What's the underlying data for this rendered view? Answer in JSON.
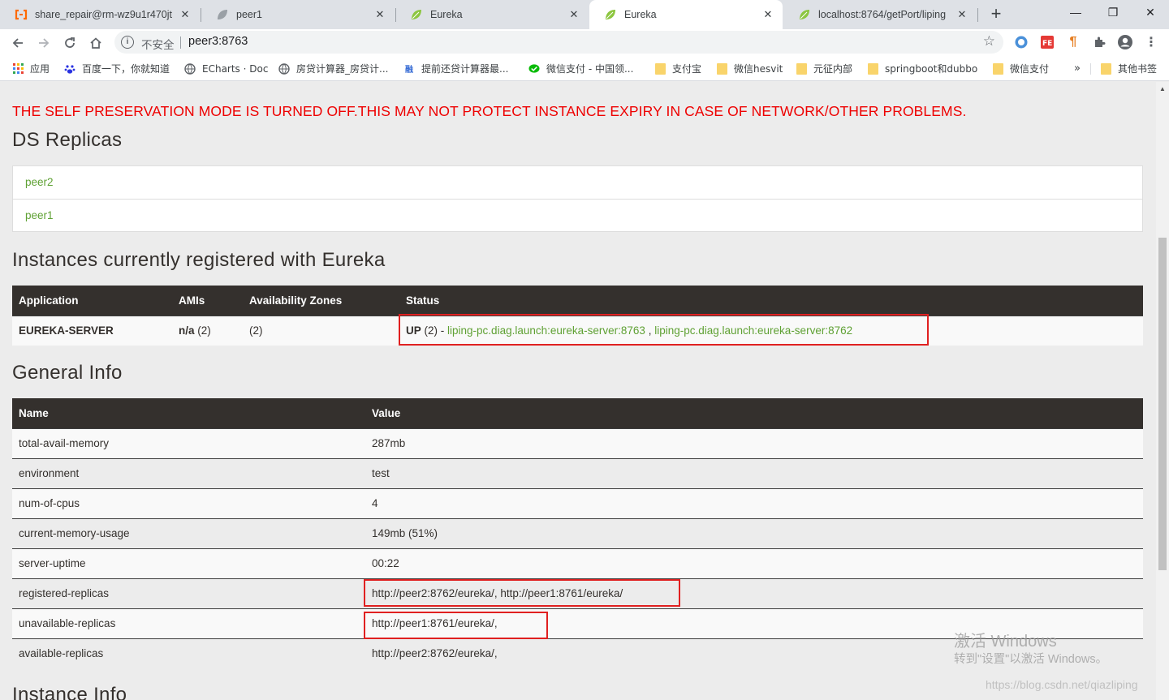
{
  "browser": {
    "tabs": [
      {
        "title": "share_repair@rm-wz9u1r470jt",
        "icon": "alibaba-cloud-icon"
      },
      {
        "title": "peer1",
        "icon": "spring-leaf-icon"
      },
      {
        "title": "Eureka",
        "icon": "spring-leaf-icon"
      },
      {
        "title": "Eureka",
        "icon": "spring-leaf-icon",
        "active": true
      },
      {
        "title": "localhost:8764/getPort/liping",
        "icon": "spring-leaf-icon"
      }
    ],
    "new_tab": "+",
    "window_controls": {
      "minimize": "—",
      "maximize": "❐",
      "close": "✕"
    },
    "address": {
      "security_label": "不安全",
      "url": "peer3:8763"
    },
    "bookmarks": [
      {
        "label": "应用",
        "icon": "apps-grid-icon"
      },
      {
        "label": "百度一下，你就知道",
        "icon": "baidu-paw-icon"
      },
      {
        "label": "ECharts · Doc",
        "icon": "globe-icon"
      },
      {
        "label": "房贷计算器_房贷计...",
        "icon": "globe-icon"
      },
      {
        "label": "提前还贷计算器最...",
        "icon": "rong-icon"
      },
      {
        "label": "微信支付 - 中国领...",
        "icon": "wechat-pay-icon"
      },
      {
        "label": "支付宝",
        "icon": "folder-icon"
      },
      {
        "label": "微信hesvit",
        "icon": "folder-icon"
      },
      {
        "label": "元征内部",
        "icon": "folder-icon"
      },
      {
        "label": "springboot和dubbo",
        "icon": "folder-icon"
      },
      {
        "label": "微信支付",
        "icon": "folder-icon"
      }
    ],
    "bookmarks_overflow": "»",
    "other_bookmarks": "其他书签"
  },
  "page": {
    "warning": "THE SELF PRESERVATION MODE IS TURNED OFF.THIS MAY NOT PROTECT INSTANCE EXPIRY IN CASE OF NETWORK/OTHER PROBLEMS.",
    "replicas_title": "DS Replicas",
    "replicas": [
      "peer2",
      "peer1"
    ],
    "instances_title": "Instances currently registered with Eureka",
    "instances_headers": {
      "application": "Application",
      "amis": "AMIs",
      "zones": "Availability Zones",
      "status": "Status"
    },
    "instances": [
      {
        "application": "EUREKA-SERVER",
        "amis_value": "n/a",
        "amis_count": "(2)",
        "zones": "(2)",
        "status_prefix": "UP",
        "status_count": "(2) - ",
        "link1": "liping-pc.diag.launch:eureka-server:8763",
        "separator": " , ",
        "link2": "liping-pc.diag.launch:eureka-server:8762"
      }
    ],
    "general_title": "General Info",
    "general_headers": {
      "name": "Name",
      "value": "Value"
    },
    "general_rows": [
      {
        "name": "total-avail-memory",
        "value": "287mb"
      },
      {
        "name": "environment",
        "value": "test"
      },
      {
        "name": "num-of-cpus",
        "value": "4"
      },
      {
        "name": "current-memory-usage",
        "value": "149mb (51%)"
      },
      {
        "name": "server-uptime",
        "value": "00:22"
      },
      {
        "name": "registered-replicas",
        "value": "http://peer2:8762/eureka/, http://peer1:8761/eureka/"
      },
      {
        "name": "unavailable-replicas",
        "value": "http://peer1:8761/eureka/,"
      },
      {
        "name": "available-replicas",
        "value": "http://peer2:8762/eureka/,"
      }
    ],
    "instance_info_title": "Instance Info"
  },
  "watermark": {
    "line1": "激活 Windows",
    "line2": "转到\"设置\"以激活 Windows。",
    "blog": "https://blog.csdn.net/qiazliping"
  }
}
